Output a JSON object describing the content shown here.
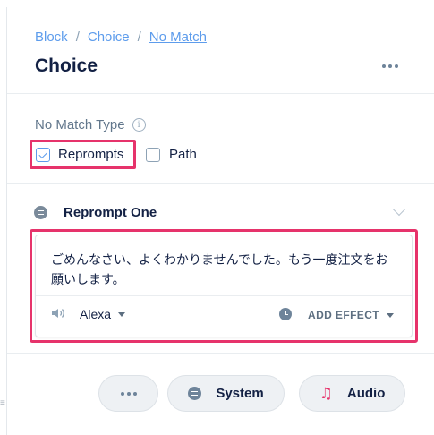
{
  "breadcrumb": {
    "items": [
      "Block",
      "Choice"
    ],
    "current": "No Match",
    "separator": "/"
  },
  "page_title": "Choice",
  "no_match": {
    "label": "No Match Type",
    "options": [
      {
        "label": "Reprompts",
        "checked": true
      },
      {
        "label": "Path",
        "checked": false
      }
    ]
  },
  "reprompt": {
    "title": "Reprompt One",
    "text": "ごめんなさい、よくわかりませんでした。もう一度注文をお願いします。",
    "voice": "Alexa",
    "add_effect": "ADD EFFECT"
  },
  "actions": {
    "system": "System",
    "audio": "Audio"
  },
  "colors": {
    "accent": "#5d9cec",
    "highlight": "#e6336b",
    "text": "#132144"
  }
}
